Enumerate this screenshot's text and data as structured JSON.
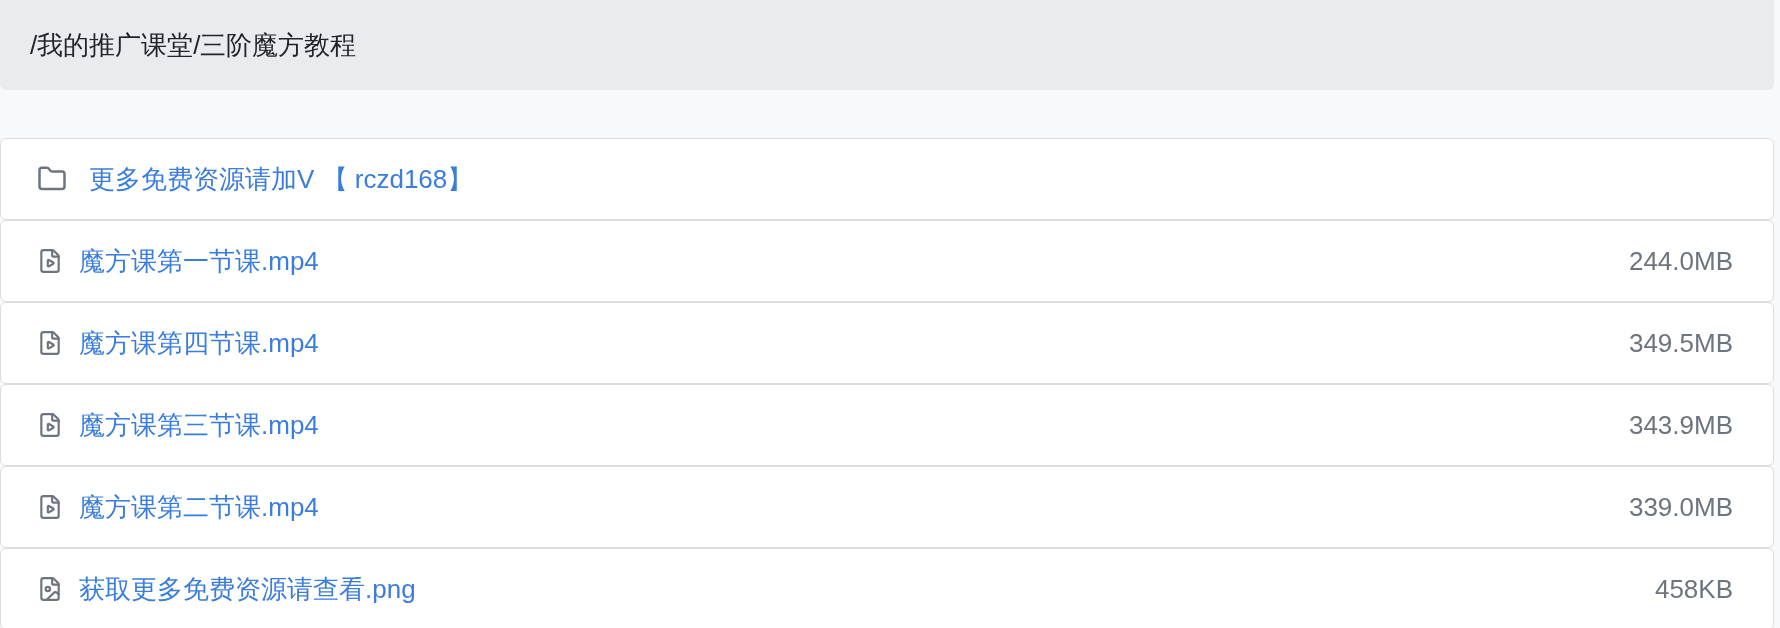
{
  "breadcrumb": "/我的推广课堂/三阶魔方教程",
  "items": [
    {
      "kind": "folder",
      "name": "更多免费资源请加V 【 rczd168】"
    },
    {
      "kind": "video",
      "name": "魔方课第一节课.mp4",
      "size": "244.0MB"
    },
    {
      "kind": "video",
      "name": "魔方课第四节课.mp4",
      "size": "349.5MB"
    },
    {
      "kind": "video",
      "name": "魔方课第三节课.mp4",
      "size": "343.9MB"
    },
    {
      "kind": "video",
      "name": "魔方课第二节课.mp4",
      "size": "339.0MB"
    },
    {
      "kind": "image",
      "name": "获取更多免费资源请查看.png",
      "size": "458KB"
    }
  ]
}
